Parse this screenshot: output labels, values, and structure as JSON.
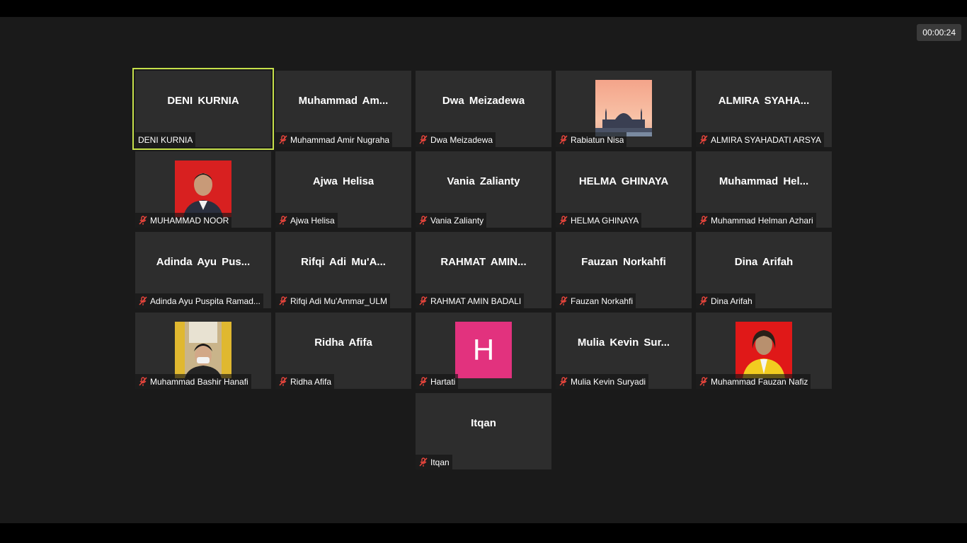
{
  "timer": "00:00:24",
  "colors": {
    "active_border": "#c6e04a",
    "mute_icon": "#e8453c",
    "hartati_avatar": "#e2327e"
  },
  "participants": [
    {
      "display": "DENI KURNIA",
      "label": "DENI KURNIA",
      "muted": false,
      "active": true
    },
    {
      "display": "Muhammad  Am...",
      "label": "Muhammad Amir Nugraha",
      "muted": true
    },
    {
      "display": "Dwa Meizadewa",
      "label": "Dwa Meizadewa",
      "muted": true
    },
    {
      "display": "",
      "label": "Rabiatun Nisa",
      "muted": true,
      "avatar": "mosque-sunset-photo"
    },
    {
      "display": "ALMIRA  SYAHA...",
      "label": "ALMIRA SYAHADATI ARSYA",
      "muted": true
    },
    {
      "display": "",
      "label": "MUHAMMAD NOOR",
      "muted": true,
      "avatar": "portrait-red-background-photo"
    },
    {
      "display": "Ajwa Helisa",
      "label": "Ajwa Helisa",
      "muted": true
    },
    {
      "display": "Vania Zalianty",
      "label": "Vania Zalianty",
      "muted": true
    },
    {
      "display": "HELMA GHINAYA",
      "label": "HELMA GHINAYA",
      "muted": true
    },
    {
      "display": "Muhammad  Hel...",
      "label": "Muhammad Helman Azhari",
      "muted": true
    },
    {
      "display": "Adinda Ayu Pus...",
      "label": "Adinda Ayu Puspita Ramad...",
      "muted": true
    },
    {
      "display": "Rifqi  Adi  Mu'A...",
      "label": "Rifqi Adi Mu'Ammar_ULM",
      "muted": true
    },
    {
      "display": "RAHMAT  AMIN...",
      "label": "RAHMAT AMIN BADALI",
      "muted": true
    },
    {
      "display": "Fauzan Norkahfi",
      "label": "Fauzan Norkahfi",
      "muted": true
    },
    {
      "display": "Dina Arifah",
      "label": "Dina Arifah",
      "muted": true
    },
    {
      "display": "",
      "label": "Muhammad Bashir Hanafi",
      "muted": true,
      "avatar": "masked-person-photo"
    },
    {
      "display": "Ridha Afifa",
      "label": "Ridha Afifa",
      "muted": true
    },
    {
      "display": "",
      "label": "Hartati",
      "muted": true,
      "avatar_letter": "H"
    },
    {
      "display": "Mulia  Kevin  Sur...",
      "label": "Mulia Kevin Suryadi",
      "muted": true
    },
    {
      "display": "",
      "label": "Muhammad Fauzan Nafiz",
      "muted": true,
      "avatar": "portrait-yellow-jacket-photo"
    },
    {
      "display": "Itqan",
      "label": "Itqan",
      "muted": true
    }
  ]
}
